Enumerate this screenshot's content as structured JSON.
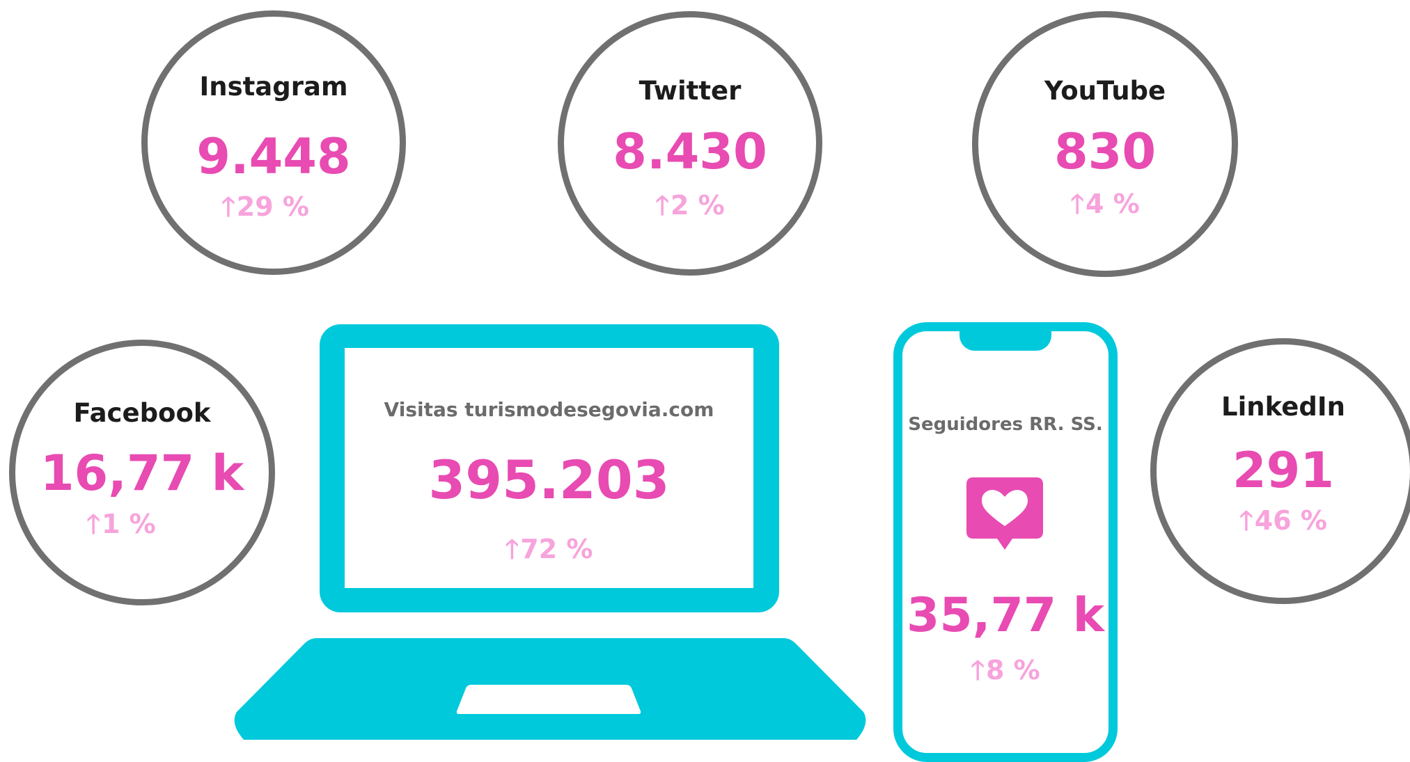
{
  "instagram": {
    "label": "Instagram",
    "value": "9.448",
    "change": "29 %"
  },
  "twitter": {
    "label": "Twitter",
    "value": "8.430",
    "change": "2 %"
  },
  "youtube": {
    "label": "YouTube",
    "value": "830",
    "change": "4 %"
  },
  "facebook": {
    "label": "Facebook",
    "value": "16,77 k",
    "change": "1 %"
  },
  "linkedin": {
    "label": "LinkedIn",
    "value": "291",
    "change": "46 %"
  },
  "web": {
    "label": "Visitas turismodesegovia.com",
    "value": "395.203",
    "change": "72 %"
  },
  "followers": {
    "label": "Seguidores RR. SS.",
    "value": "35,77 k",
    "change": "8 %"
  },
  "icons": {
    "arrow": "up-arrow-icon",
    "heart": "heart-speech-bubble-icon"
  },
  "colors": {
    "value": "#e84bb2",
    "change": "#f7a3dc",
    "device": "#00c9db",
    "ring": "#707070",
    "heart_bubble": "#e84bb2"
  }
}
